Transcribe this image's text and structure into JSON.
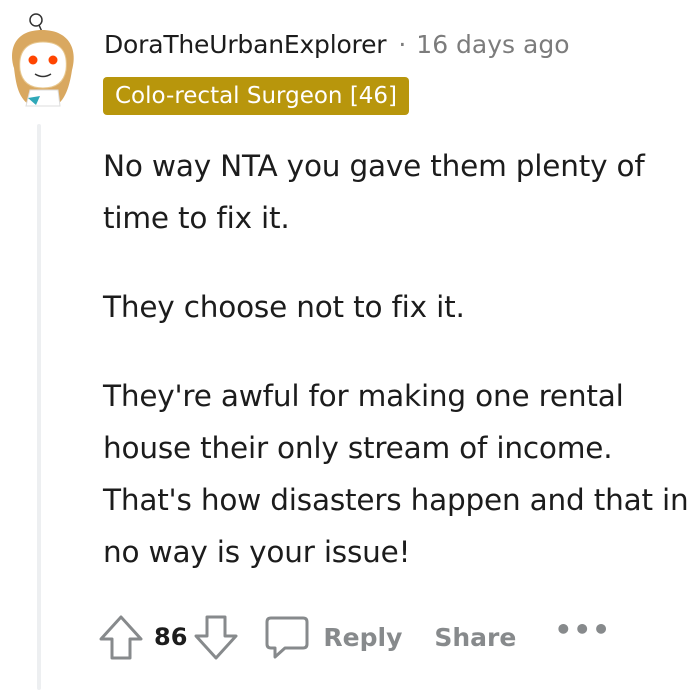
{
  "comment": {
    "username": "DoraTheUrbanExplorer",
    "separator": "·",
    "timestamp": "16 days ago",
    "flair": "Colo-rectal Surgeon [46]",
    "paragraphs": [
      "No way NTA you gave them plenty of time to fix it.",
      "They choose not to fix it.",
      "They're awful for making one rental house their only stream of income. That's how disasters happen and that in no way is your issue!"
    ],
    "score": "86",
    "reply_label": "Reply",
    "share_label": "Share",
    "more_label": "•••"
  },
  "icons": {
    "avatar": "snoo-avatar",
    "upvote": "upvote-arrow-icon",
    "downvote": "downvote-arrow-icon",
    "reply": "speech-bubble-icon"
  },
  "colors": {
    "flair_bg": "#b8960c",
    "meta_text": "#7c7c7c",
    "action_text": "#878a8c"
  }
}
